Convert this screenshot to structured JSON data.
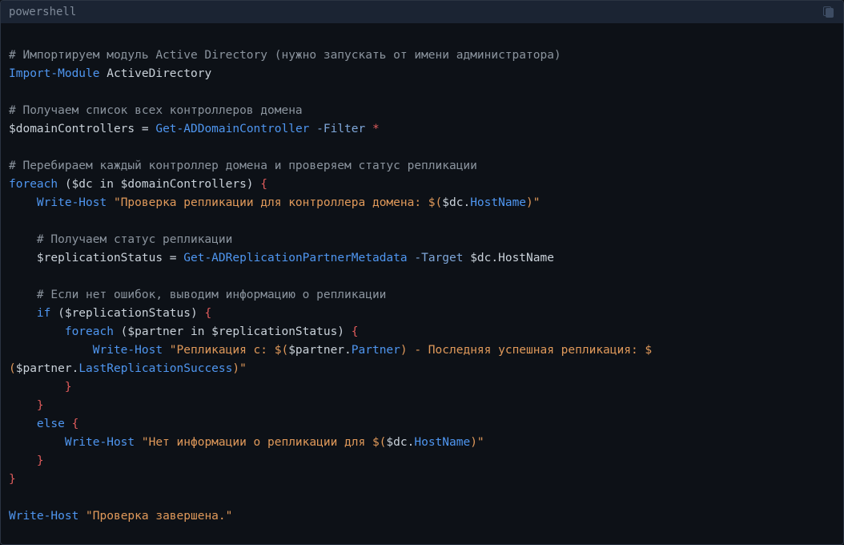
{
  "header": {
    "language": "powershell",
    "copy_icon": "copy-icon"
  },
  "code": {
    "l1": "# Импортируем модуль Active Directory (нужно запускать от имени администратора)",
    "l2_cmd": "Import-Module",
    "l2_arg": " ActiveDirectory",
    "l4": "# Получаем список всех контроллеров домена",
    "l5_var": "$domainControllers",
    "l5_eq": " = ",
    "l5_cmd": "Get-ADDomainController",
    "l5_param": " -Filter",
    "l5_star": " *",
    "l7": "# Перебираем каждый контроллер домена и проверяем статус репликации",
    "l8_kw": "foreach",
    "l8_rest": " ($dc in $domainControllers) ",
    "brace_open": "{",
    "brace_close": "}",
    "l9_indent": "    ",
    "l9_cmd": "Write-Host",
    "l9_str1": " \"Проверка репликации для контроллера домена: $(",
    "l9_var": "$dc",
    "l9_dot": ".",
    "l9_prop": "HostName",
    "l9_str2": ")\"",
    "l11": "    # Получаем статус репликации",
    "l12_var": "    $replicationStatus",
    "l12_eq": " = ",
    "l12_cmd": "Get-ADReplicationPartnerMetadata",
    "l12_param": " -Target",
    "l12_arg": " $dc.HostName",
    "l14": "    # Если нет ошибок, выводим информацию о репликации",
    "l15_kw": "    if",
    "l15_rest": " ($replicationStatus) ",
    "l16_kw": "        foreach",
    "l16_rest": " ($partner in $replicationStatus) ",
    "l17_cmd": "            Write-Host",
    "l17_str1": " \"Репликация с: $(",
    "l17_var": "$partner",
    "l17_dot": ".",
    "l17_prop": "Partner",
    "l17_str2": ") - Последняя успешная репликация: $",
    "l18_str1": "(",
    "l18_var": "$partner",
    "l18_dot": ".",
    "l18_prop": "LastReplicationSuccess",
    "l18_str2": ")\"",
    "l19": "        }",
    "l20": "    }",
    "l21_kw": "    else",
    "l21_sp": " ",
    "l22_cmd": "        Write-Host",
    "l22_str1": " \"Нет информации о репликации для $(",
    "l22_var": "$dc",
    "l22_dot": ".",
    "l22_prop": "HostName",
    "l22_str2": ")\"",
    "l23": "    }",
    "l24": "}",
    "l26_cmd": "Write-Host",
    "l26_str": " \"Проверка завершена.\""
  }
}
